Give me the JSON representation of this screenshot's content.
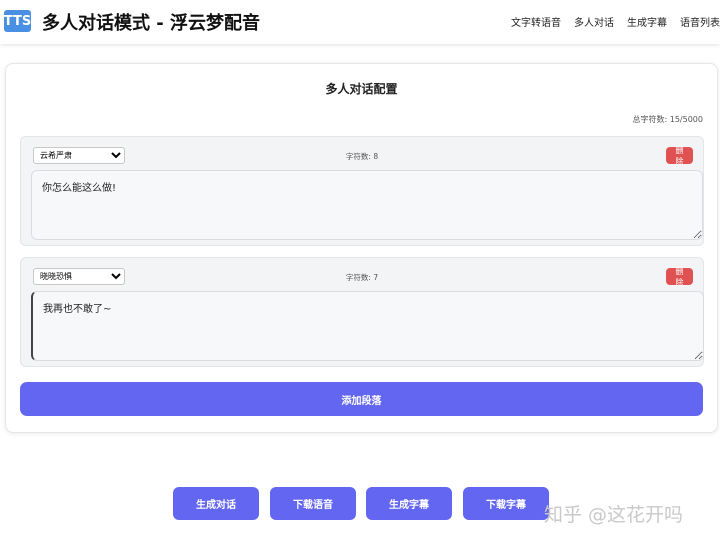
{
  "header": {
    "logo": "TTS",
    "title": "多人对话模式 - 浮云梦配音",
    "nav": [
      "文字转语音",
      "多人对话",
      "生成字幕",
      "语音列表"
    ]
  },
  "config": {
    "title": "多人对话配置",
    "total_chars": "总字符数: 15/5000",
    "segments": [
      {
        "voice": "云希严肃",
        "char_count": "字符数: 8",
        "delete_label": "删除",
        "text": "你怎么能这么做!"
      },
      {
        "voice": "晓晓恐惧",
        "char_count": "字符数: 7",
        "delete_label": "删除",
        "text": "我再也不敢了~"
      }
    ],
    "add_label": "添加段落"
  },
  "actions": [
    "生成对话",
    "下载语音",
    "生成字幕",
    "下载字幕"
  ],
  "watermark": "知乎 @这花开吗",
  "colors": {
    "accent": "#6366f1",
    "danger": "#e05252",
    "logo": "#4a90e2"
  }
}
